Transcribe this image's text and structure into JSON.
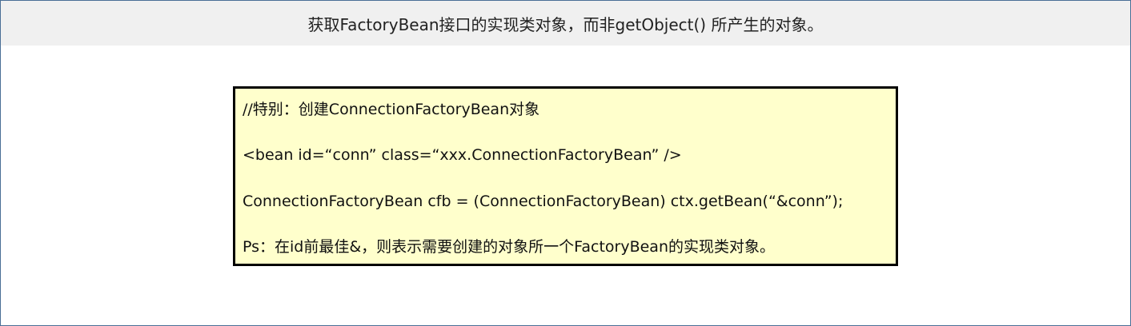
{
  "header": {
    "title": "获取FactoryBean接口的实现类对象，而非getObject() 所产生的对象。"
  },
  "code_box": {
    "lines": [
      "//特别：创建ConnectionFactoryBean对象",
      "<bean id=“conn” class=“xxx.ConnectionFactoryBean” />",
      "ConnectionFactoryBean cfb = (ConnectionFactoryBean) ctx.getBean(“&conn”);",
      "Ps：在id前最佳&，则表示需要创建的对象所一个FactoryBean的实现类对象。"
    ]
  },
  "colors": {
    "header_bg": "#f0f0f0",
    "code_bg": "#ffffcc",
    "border": "#000000",
    "frame_border": "#4a6f96"
  }
}
